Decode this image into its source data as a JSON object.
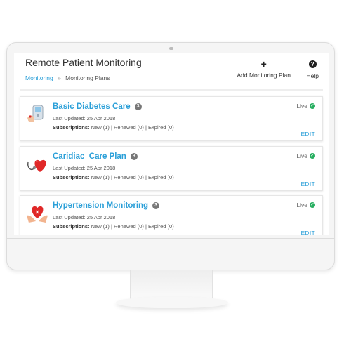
{
  "page": {
    "title": "Remote Patient Monitoring",
    "breadcrumb": {
      "root": "Monitoring",
      "separator": "»",
      "current": "Monitoring Plans"
    }
  },
  "toolbar": {
    "add_icon": "+",
    "add_label": "Add Monitoring Plan",
    "help_icon": "?",
    "help_label": "Help"
  },
  "plans": [
    {
      "name": "Basic Diabetes Care",
      "count": "3",
      "last_updated": "Last Updated: 25 Apr 2018",
      "subs_label": "Subscriptions:",
      "subs_values": "New (1)  | Renewed (0)  | Expired (0)",
      "status": "Live",
      "edit": "EDIT",
      "icon": "glucose-meter-icon"
    },
    {
      "name": "Caridiac  Care Plan",
      "count": "3",
      "last_updated": "Last Updated: 25 Apr 2018",
      "subs_label": "Subscriptions:",
      "subs_values": "New (1)  | Renewed (0)  | Expired (0)",
      "status": "Live",
      "edit": "EDIT",
      "icon": "heart-stethoscope-icon"
    },
    {
      "name": "Hypertension Monitoring",
      "count": "3",
      "last_updated": "Last Updated: 25 Apr 2018",
      "subs_label": "Subscriptions:",
      "subs_values": "New (1)  | Renewed (0)  | Expired (0)",
      "status": "Live",
      "edit": "EDIT",
      "icon": "hands-heart-icon"
    }
  ],
  "colors": {
    "link": "#2a9fd8",
    "live": "#27ae60",
    "badge": "#777777"
  }
}
